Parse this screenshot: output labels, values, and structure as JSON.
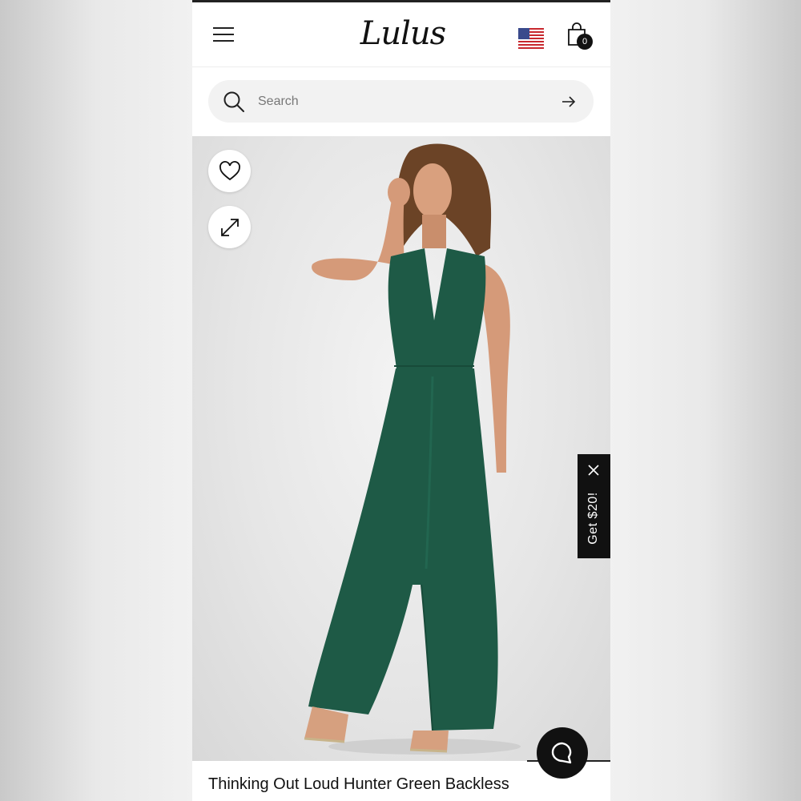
{
  "header": {
    "logo_text": "Lulus",
    "cart_count": "0",
    "country_icon": "us-flag-icon"
  },
  "search": {
    "placeholder": "Search"
  },
  "product": {
    "title": "Thinking Out Loud Hunter Green Backless",
    "image_alt": "Model wearing hunter green backless wide-leg jumpsuit"
  },
  "promo": {
    "label": "Get $20!"
  },
  "icons": {
    "menu": "hamburger-menu-icon",
    "cart": "shopping-bag-icon",
    "search": "search-icon",
    "submit": "arrow-right-icon",
    "wishlist": "heart-icon",
    "expand": "expand-icon",
    "close": "close-icon",
    "chat": "chat-bubble-icon"
  },
  "colors": {
    "brand_black": "#111111",
    "search_bg": "#f2f2f2",
    "product_green": "#1e5a46"
  }
}
